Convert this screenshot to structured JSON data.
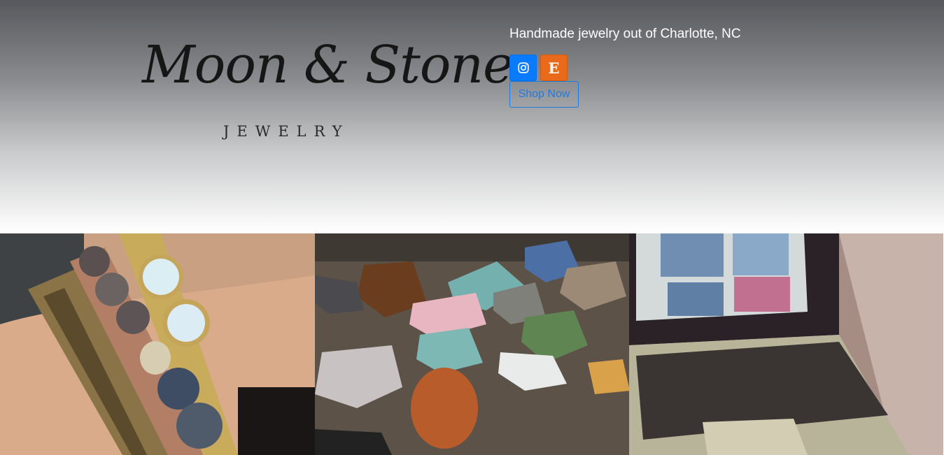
{
  "hero": {
    "logo": {
      "script_text": "Moon & Stone",
      "subtitle": "JEWELRY"
    },
    "tagline": "Handmade jewelry out of Charlotte, NC",
    "social": [
      {
        "name": "instagram",
        "icon": "instagram-icon",
        "color": "#0a7bff"
      },
      {
        "name": "etsy",
        "icon": "etsy-icon",
        "glyph": "E",
        "color": "#ea6a1b"
      }
    ],
    "shop_button": "Shop Now"
  },
  "gallery": [
    {
      "subject": "bracelets-on-wrist"
    },
    {
      "subject": "raw-stones"
    },
    {
      "subject": "laptop-shop"
    }
  ],
  "colors": {
    "accent": "#1f7ae0",
    "hero_top": "#55585c"
  }
}
